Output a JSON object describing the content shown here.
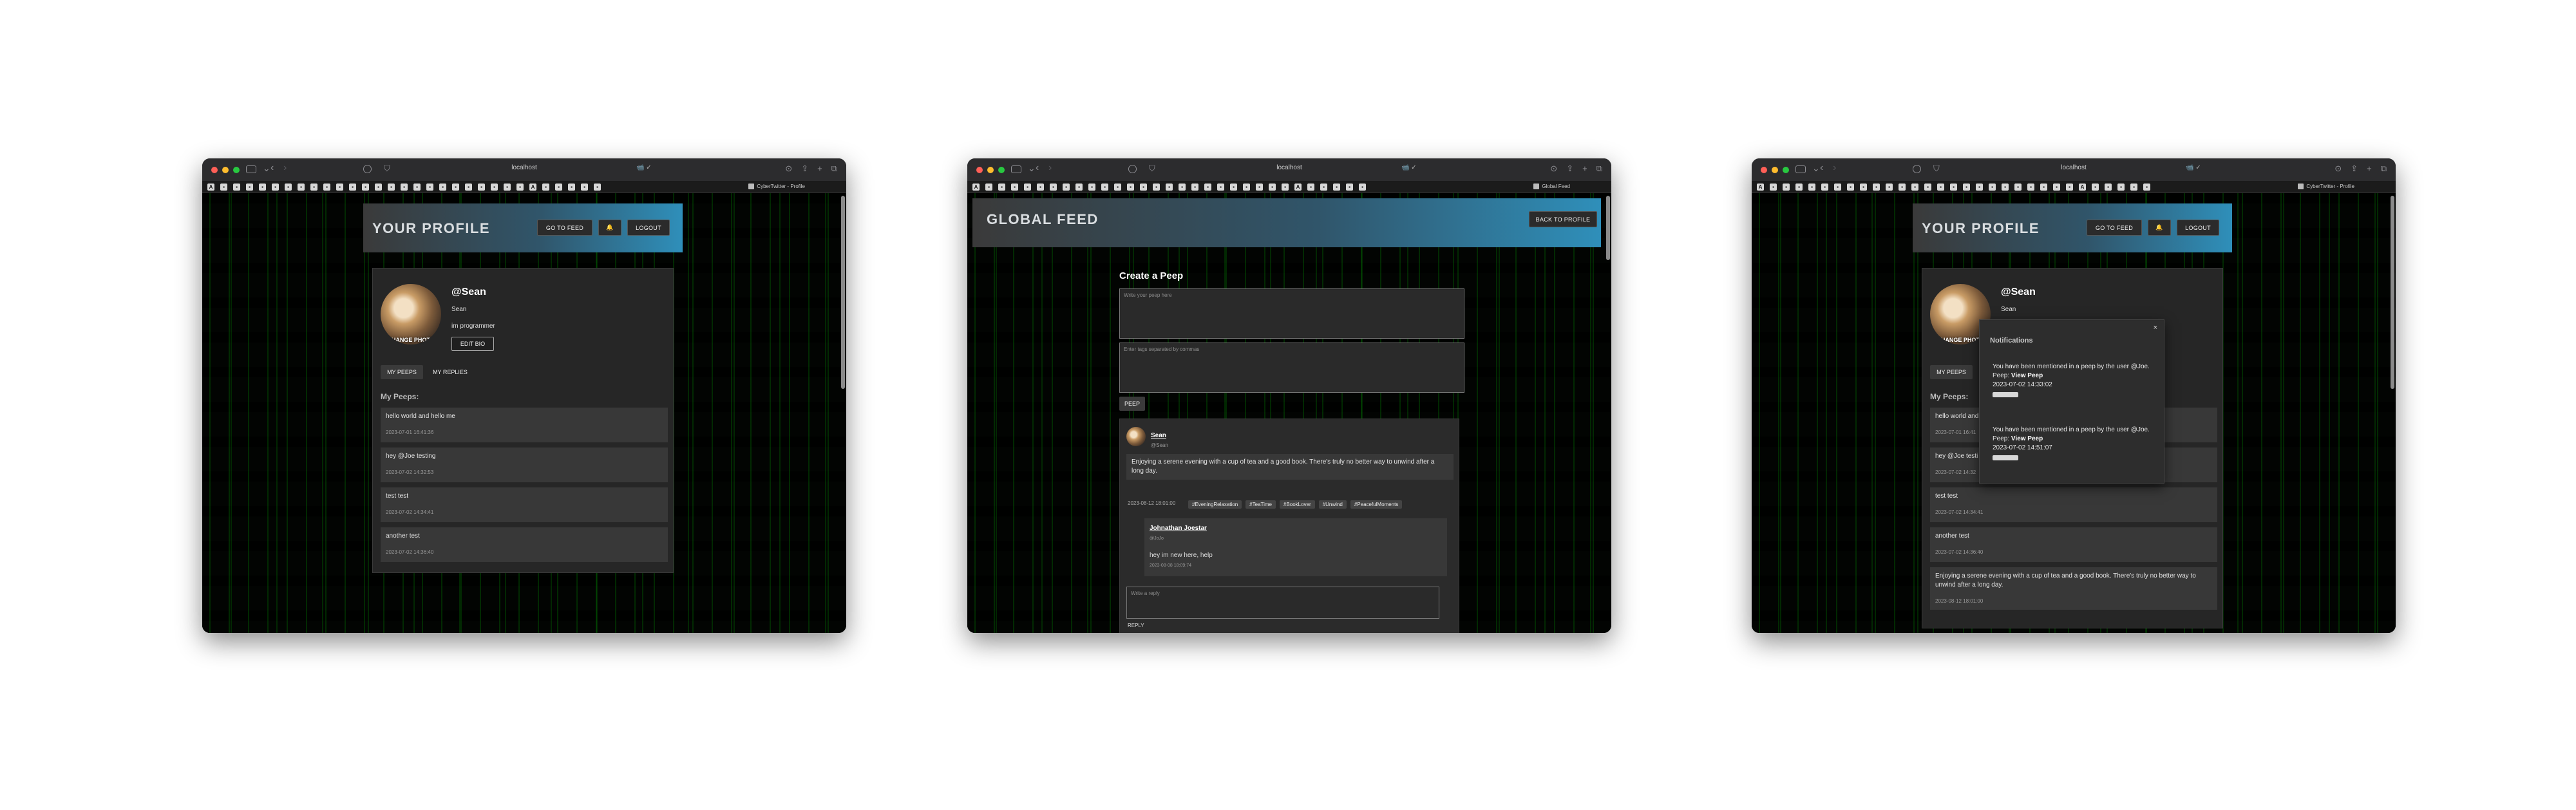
{
  "browser": {
    "url": "localhost",
    "tab_profile": "CyberTwitter - Profile",
    "tab_feed": "Global Feed",
    "camera_label": "📹 ✓"
  },
  "profile_page": {
    "header_title": "YOUR PROFILE",
    "go_to_feed": "GO TO FEED",
    "bell": "🔔",
    "logout": "LOGOUT",
    "change_photo": "CHANGE PHOTO",
    "username": "@Sean",
    "display_name": "Sean",
    "bio": "im programmer",
    "edit_bio": "EDIT BIO",
    "tab_peeps": "MY PEEPS",
    "tab_replies": "MY REPLIES",
    "my_peeps_label": "My Peeps:",
    "peeps": [
      {
        "text": "hello world and hello me",
        "date": "2023-07-01 16:41:36"
      },
      {
        "text": "hey @Joe testing",
        "date": "2023-07-02 14:32:53"
      },
      {
        "text": "test test",
        "date": "2023-07-02 14:34:41"
      },
      {
        "text": "another test",
        "date": "2023-07-02 14:36:40"
      }
    ]
  },
  "feed_page": {
    "header_title": "GLOBAL FEED",
    "back_to_profile": "BACK TO PROFILE",
    "create_heading": "Create a Peep",
    "text_placeholder": "Write your peep here",
    "tags_placeholder": "Enter tags separated by commas",
    "peep_button": "PEEP",
    "post": {
      "author": "Sean",
      "handle": "@Sean",
      "text": "Enjoying a serene evening with a cup of tea and a good book. There's truly no better way to unwind after a long day.",
      "date": "2023-08-12 18:01:00",
      "tags": [
        "#EveningRelaxation",
        "#TeaTime",
        "#BookLover",
        "#Unwind",
        "#PeacefulMoments"
      ]
    },
    "reply": {
      "author": "Johnathan Joestar",
      "handle": "@JoJo",
      "date": "2023-08-08 18:09:74",
      "text": "hey im new here, help"
    },
    "reply_placeholder": "Write a reply",
    "reply_button": "REPLY"
  },
  "notifications": {
    "title": "Notifications",
    "close": "×",
    "items": [
      {
        "msg": "You have been mentioned in a peep by the user @Joe.",
        "peep_label": "Peep:",
        "view": "View Peep",
        "date": "2023-07-02 14:33:02"
      },
      {
        "msg": "You have been mentioned in a peep by the user @Joe.",
        "peep_label": "Peep:",
        "view": "View Peep",
        "date": "2023-07-02 14:51:07"
      }
    ]
  },
  "profile_page_3": {
    "peeps": [
      {
        "text": "hello world and",
        "date": "2023-07-01 16:41"
      },
      {
        "text": "hey @Joe testi",
        "date": "2023-07-02 14:32"
      },
      {
        "text": "test test",
        "date": "2023-07-02 14:34:41"
      },
      {
        "text": "another test",
        "date": "2023-07-02 14:36:40"
      },
      {
        "text": "Enjoying a serene evening with a cup of tea and a good book. There's truly no better way to unwind after a long day.",
        "date": "2023-08-12 18:01:00"
      }
    ]
  },
  "colors": {
    "header_start": "#3a3a3a",
    "header_end": "#2f8fba",
    "card_bg": "#262626",
    "matrix_green": "#00aa00"
  }
}
